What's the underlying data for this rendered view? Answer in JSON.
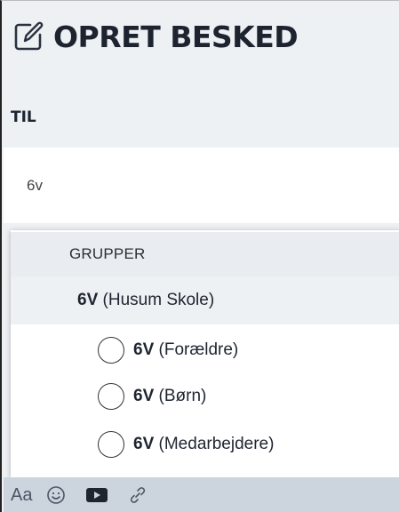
{
  "header": {
    "title": "OPRET BESKED",
    "icon": "edit-icon"
  },
  "recipient": {
    "label": "TIL",
    "value": "6v"
  },
  "dropdown": {
    "section_label": "GRUPPER",
    "group": {
      "code": "6V",
      "name": "(Husum Skole)"
    },
    "options": [
      {
        "code": "6V",
        "name": "(Forældre)"
      },
      {
        "code": "6V",
        "name": "(Børn)"
      },
      {
        "code": "6V",
        "name": "(Medarbejdere)"
      }
    ]
  },
  "toolbar": {
    "format_label": "Aa",
    "icons": [
      "emoji-icon",
      "video-icon",
      "link-icon"
    ]
  },
  "colors": {
    "page_background": "#eef1f4",
    "toolbar_background": "#ccd4dd",
    "group_header_background": "#e9ecf0",
    "title_color": "#1d2430"
  }
}
